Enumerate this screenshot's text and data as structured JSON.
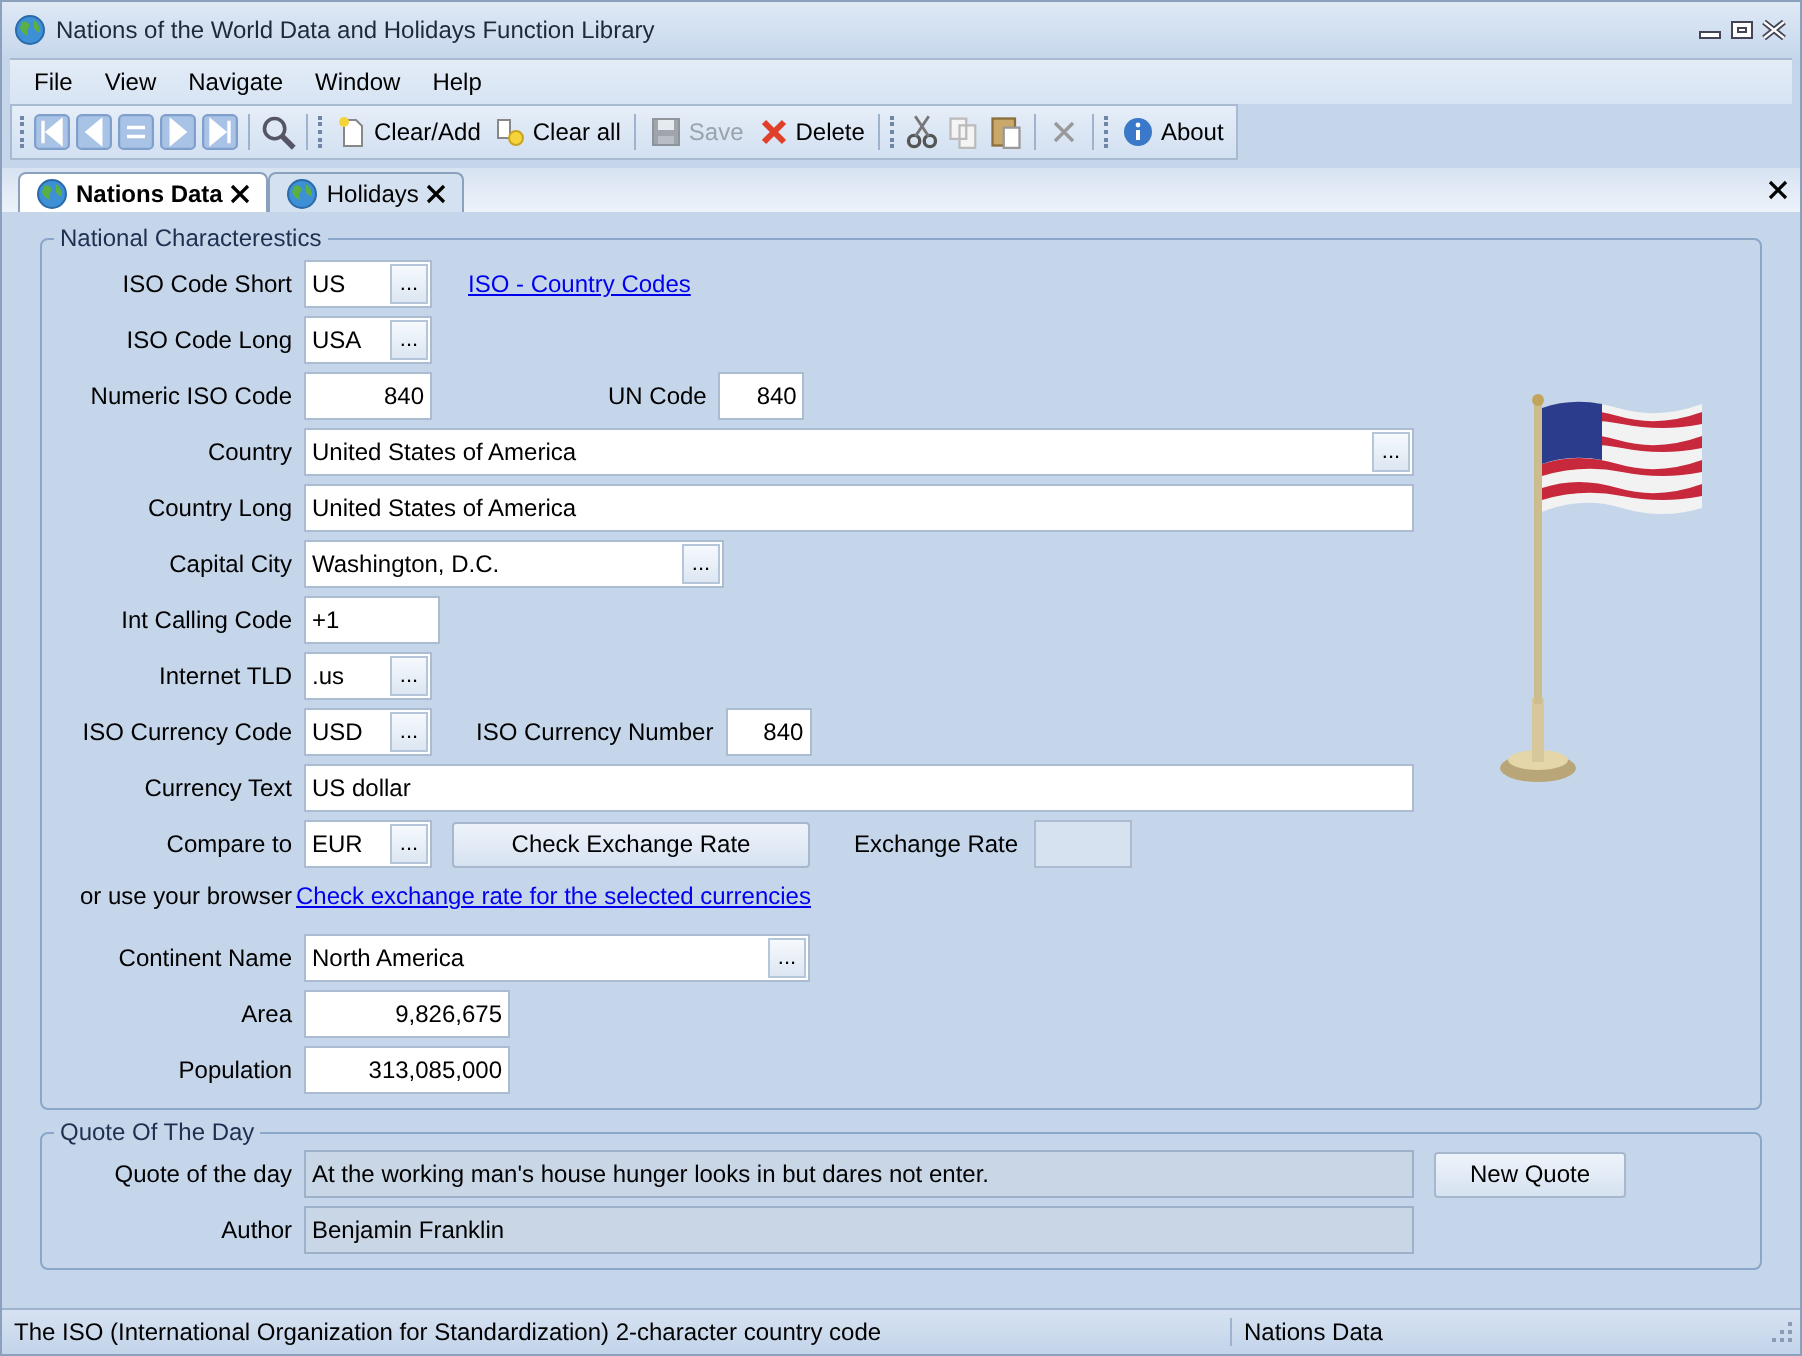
{
  "window": {
    "title": "Nations of the World Data and Holidays Function Library"
  },
  "menu": [
    "File",
    "View",
    "Navigate",
    "Window",
    "Help"
  ],
  "toolbar": {
    "clear_add": "Clear/Add",
    "clear_all": "Clear all",
    "save": {
      "label": "Save",
      "disabled": true
    },
    "delete": "Delete",
    "about": "About"
  },
  "tabs": [
    {
      "label": "Nations Data",
      "selected": true
    },
    {
      "label": "Holidays",
      "selected": false
    }
  ],
  "national": {
    "title": "National Characterestics",
    "iso_short": {
      "label": "ISO Code Short",
      "value": "US",
      "browse": "..."
    },
    "iso_link": "ISO - Country Codes",
    "iso_long": {
      "label": "ISO Code Long",
      "value": "USA",
      "browse": "..."
    },
    "numeric_iso": {
      "label": "Numeric ISO Code",
      "value": "840"
    },
    "un_code": {
      "label": "UN Code",
      "value": "840"
    },
    "country": {
      "label": "Country",
      "value": "United States of America",
      "browse": "..."
    },
    "country_long": {
      "label": "Country Long",
      "value": "United States of America"
    },
    "capital": {
      "label": "Capital City",
      "value": "Washington, D.C.",
      "browse": "..."
    },
    "calling_code": {
      "label": "Int Calling Code",
      "value": "+1"
    },
    "tld": {
      "label": "Internet TLD",
      "value": ".us",
      "browse": "..."
    },
    "currency_code": {
      "label": "ISO Currency Code",
      "value": "USD",
      "browse": "..."
    },
    "currency_number": {
      "label": "ISO Currency Number",
      "value": "840"
    },
    "currency_text": {
      "label": "Currency Text",
      "value": "US dollar"
    },
    "compare": {
      "label": "Compare to",
      "value": "EUR",
      "browse": "..."
    },
    "check_button": "Check Exchange Rate",
    "exchange_rate": {
      "label": "Exchange Rate"
    },
    "browser_text": "or use your browser",
    "browser_link": "Check exchange rate for the selected currencies",
    "continent": {
      "label": "Continent Name",
      "value": "North America",
      "browse": "..."
    },
    "area": {
      "label": "Area",
      "value": "9,826,675"
    },
    "population": {
      "label": "Population",
      "value": "313,085,000"
    }
  },
  "quote": {
    "title": "Quote Of The Day",
    "quote": {
      "label": "Quote of the day",
      "value": "At the working man's house hunger looks in but dares not enter."
    },
    "new_quote": "New Quote",
    "author": {
      "label": "Author",
      "value": "Benjamin Franklin"
    }
  },
  "status_bar": [
    "The ISO (International Organization for Standardization) 2-character country code",
    "Nations Data"
  ]
}
